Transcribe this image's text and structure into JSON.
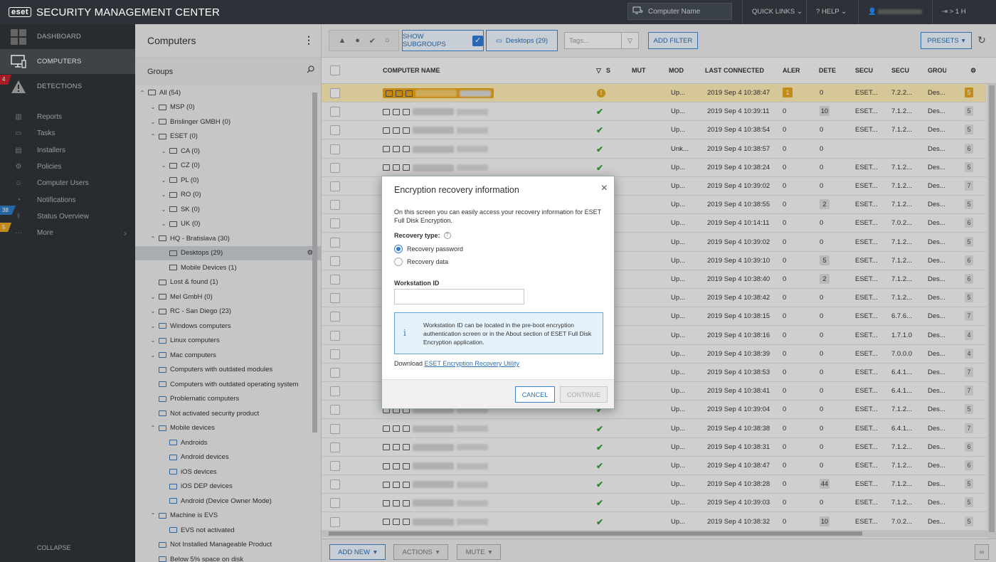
{
  "app": {
    "brand": "eset",
    "title": "SECURITY MANAGEMENT CENTER",
    "search_placeholder": "Computer Name",
    "quick_links": "QUICK LINKS",
    "help": "HELP",
    "logout": "> 1 H"
  },
  "sidebar": {
    "main": [
      {
        "label": "DASHBOARD",
        "icon": "dashboard-icon"
      },
      {
        "label": "COMPUTERS",
        "icon": "computers-icon"
      },
      {
        "label": "DETECTIONS",
        "icon": "warning-icon"
      }
    ],
    "sub": [
      {
        "label": "Reports",
        "icon": "reports-icon"
      },
      {
        "label": "Tasks",
        "icon": "tasks-icon"
      },
      {
        "label": "Installers",
        "icon": "installers-icon"
      },
      {
        "label": "Policies",
        "icon": "policies-icon"
      },
      {
        "label": "Computer Users",
        "icon": "user-icon"
      },
      {
        "label": "Notifications",
        "icon": "bell-icon"
      },
      {
        "label": "Status Overview",
        "icon": "status-icon"
      },
      {
        "label": "More",
        "icon": "more-icon"
      }
    ],
    "badges": {
      "detections": "4",
      "status": "38",
      "more": "5"
    },
    "collapse": "COLLAPSE"
  },
  "tree": {
    "title": "Computers",
    "groups_label": "Groups",
    "nodes": [
      {
        "label": "All (54)",
        "level": 0,
        "caret": "up",
        "dyn": false
      },
      {
        "label": "MSP (0)",
        "level": 1,
        "caret": "down",
        "dyn": false
      },
      {
        "label": "Brislinger GMBH (0)",
        "level": 1,
        "caret": "down",
        "dyn": false
      },
      {
        "label": "ESET (0)",
        "level": 1,
        "caret": "up",
        "dyn": false
      },
      {
        "label": "CA (0)",
        "level": 2,
        "caret": "down",
        "dyn": false
      },
      {
        "label": "CZ (0)",
        "level": 2,
        "caret": "down",
        "dyn": false
      },
      {
        "label": "PL (0)",
        "level": 2,
        "caret": "down",
        "dyn": false
      },
      {
        "label": "RO (0)",
        "level": 2,
        "caret": "down",
        "dyn": false
      },
      {
        "label": "SK (0)",
        "level": 2,
        "caret": "down",
        "dyn": false
      },
      {
        "label": "UK (0)",
        "level": 2,
        "caret": "down",
        "dyn": false
      },
      {
        "label": "HQ - Bratislava (30)",
        "level": 1,
        "caret": "up",
        "dyn": false
      },
      {
        "label": "Desktops (29)",
        "level": 2,
        "caret": "",
        "dyn": false,
        "selected": true
      },
      {
        "label": "Mobile Devices (1)",
        "level": 2,
        "caret": "",
        "dyn": false
      },
      {
        "label": "Lost & found (1)",
        "level": 1,
        "caret": "",
        "dyn": false
      },
      {
        "label": "Mel GmbH (0)",
        "level": 1,
        "caret": "down",
        "dyn": false
      },
      {
        "label": "RC - San Diego (23)",
        "level": 1,
        "caret": "down",
        "dyn": false
      },
      {
        "label": "Windows computers",
        "level": 1,
        "caret": "down",
        "dyn": true
      },
      {
        "label": "Linux computers",
        "level": 1,
        "caret": "down",
        "dyn": true
      },
      {
        "label": "Mac computers",
        "level": 1,
        "caret": "down",
        "dyn": true
      },
      {
        "label": "Computers with outdated modules",
        "level": 1,
        "caret": "",
        "dyn": true
      },
      {
        "label": "Computers with outdated operating system",
        "level": 1,
        "caret": "",
        "dyn": true
      },
      {
        "label": "Problematic computers",
        "level": 1,
        "caret": "",
        "dyn": true
      },
      {
        "label": "Not activated security product",
        "level": 1,
        "caret": "",
        "dyn": true
      },
      {
        "label": "Mobile devices",
        "level": 1,
        "caret": "up",
        "dyn": true
      },
      {
        "label": "Androids",
        "level": 2,
        "caret": "",
        "dyn": true
      },
      {
        "label": "Android devices",
        "level": 2,
        "caret": "",
        "dyn": true
      },
      {
        "label": "iOS devices",
        "level": 2,
        "caret": "",
        "dyn": true
      },
      {
        "label": "iOS DEP devices",
        "level": 2,
        "caret": "",
        "dyn": true
      },
      {
        "label": "Android (Device Owner Mode)",
        "level": 2,
        "caret": "",
        "dyn": true
      },
      {
        "label": "Machine is EVS",
        "level": 1,
        "caret": "up",
        "dyn": true
      },
      {
        "label": "EVS not activated",
        "level": 2,
        "caret": "",
        "dyn": true
      },
      {
        "label": "Not Installed Manageable Product",
        "level": 1,
        "caret": "",
        "dyn": true
      },
      {
        "label": "Below 5% space on disk",
        "level": 1,
        "caret": "",
        "dyn": true
      }
    ]
  },
  "toolbar": {
    "show_subgroups": "SHOW SUBGROUPS",
    "group_filter": "Desktops (29)",
    "tags_placeholder": "Tags...",
    "add_filter": "ADD FILTER",
    "presets": "PRESETS"
  },
  "table": {
    "headers": [
      "COMPUTER NAME",
      "S",
      "MUT",
      "MOD",
      "LAST CONNECTED",
      "ALER",
      "DETE",
      "SECU",
      "SECU",
      "GROU"
    ],
    "rows": [
      {
        "status": "warn",
        "mod": "Up...",
        "last": "2019 Sep 4 10:38:47",
        "alerts": "1",
        "det": "0",
        "secu1": "ESET...",
        "secu2": "7.2.2...",
        "group": "Des...",
        "cnt": "5",
        "hl": true
      },
      {
        "status": "ok",
        "mod": "Up...",
        "last": "2019 Sep 4 10:39:11",
        "alerts": "0",
        "det": "10",
        "secu1": "ESET...",
        "secu2": "7.1.2...",
        "group": "Des...",
        "cnt": "5"
      },
      {
        "status": "ok",
        "mod": "Up...",
        "last": "2019 Sep 4 10:38:54",
        "alerts": "0",
        "det": "0",
        "secu1": "ESET...",
        "secu2": "7.1.2...",
        "group": "Des...",
        "cnt": "5"
      },
      {
        "status": "ok",
        "mod": "Unk...",
        "last": "2019 Sep 4 10:38:57",
        "alerts": "0",
        "det": "0",
        "secu1": "",
        "secu2": "",
        "group": "Des...",
        "cnt": "6"
      },
      {
        "status": "ok",
        "mod": "Up...",
        "last": "2019 Sep 4 10:38:24",
        "alerts": "0",
        "det": "0",
        "secu1": "ESET...",
        "secu2": "7.1.2...",
        "group": "Des...",
        "cnt": "5"
      },
      {
        "status": "ok",
        "mod": "Up...",
        "last": "2019 Sep 4 10:39:02",
        "alerts": "0",
        "det": "0",
        "secu1": "ESET...",
        "secu2": "7.1.2...",
        "group": "Des...",
        "cnt": "7"
      },
      {
        "status": "ok",
        "mod": "Up...",
        "last": "2019 Sep 4 10:38:55",
        "alerts": "0",
        "det": "2",
        "secu1": "ESET...",
        "secu2": "7.1.2...",
        "group": "Des...",
        "cnt": "5"
      },
      {
        "status": "ok",
        "mod": "Up...",
        "last": "2019 Sep 4 10:14:11",
        "alerts": "0",
        "det": "0",
        "secu1": "ESET...",
        "secu2": "7.0.2...",
        "group": "Des...",
        "cnt": "6"
      },
      {
        "status": "ok",
        "mod": "Up...",
        "last": "2019 Sep 4 10:39:02",
        "alerts": "0",
        "det": "0",
        "secu1": "ESET...",
        "secu2": "7.1.2...",
        "group": "Des...",
        "cnt": "5"
      },
      {
        "status": "ok",
        "mod": "Up...",
        "last": "2019 Sep 4 10:39:10",
        "alerts": "0",
        "det": "5",
        "secu1": "ESET...",
        "secu2": "7.1.2...",
        "group": "Des...",
        "cnt": "6"
      },
      {
        "status": "ok",
        "mod": "Up...",
        "last": "2019 Sep 4 10:38:40",
        "alerts": "0",
        "det": "2",
        "secu1": "ESET...",
        "secu2": "7.1.2...",
        "group": "Des...",
        "cnt": "6"
      },
      {
        "status": "ok",
        "mod": "Up...",
        "last": "2019 Sep 4 10:38:42",
        "alerts": "0",
        "det": "0",
        "secu1": "ESET...",
        "secu2": "7.1.2...",
        "group": "Des...",
        "cnt": "5"
      },
      {
        "status": "ok",
        "mod": "Up...",
        "last": "2019 Sep 4 10:38:15",
        "alerts": "0",
        "det": "0",
        "secu1": "ESET...",
        "secu2": "6.7.6...",
        "group": "Des...",
        "cnt": "7"
      },
      {
        "status": "ok",
        "mod": "Up...",
        "last": "2019 Sep 4 10:38:16",
        "alerts": "0",
        "det": "0",
        "secu1": "ESET...",
        "secu2": "1.7.1.0",
        "group": "Des...",
        "cnt": "4"
      },
      {
        "status": "ok",
        "mod": "Up...",
        "last": "2019 Sep 4 10:38:39",
        "alerts": "0",
        "det": "0",
        "secu1": "ESET...",
        "secu2": "7.0.0.0",
        "group": "Des...",
        "cnt": "4"
      },
      {
        "status": "ok",
        "mod": "Up...",
        "last": "2019 Sep 4 10:38:53",
        "alerts": "0",
        "det": "0",
        "secu1": "ESET...",
        "secu2": "6.4.1...",
        "group": "Des...",
        "cnt": "7"
      },
      {
        "status": "ok",
        "mod": "Up...",
        "last": "2019 Sep 4 10:38:41",
        "alerts": "0",
        "det": "0",
        "secu1": "ESET...",
        "secu2": "6.4.1...",
        "group": "Des...",
        "cnt": "7"
      },
      {
        "status": "ok",
        "mod": "Up...",
        "last": "2019 Sep 4 10:39:04",
        "alerts": "0",
        "det": "0",
        "secu1": "ESET...",
        "secu2": "7.1.2...",
        "group": "Des...",
        "cnt": "5"
      },
      {
        "status": "ok",
        "mod": "Up...",
        "last": "2019 Sep 4 10:38:38",
        "alerts": "0",
        "det": "0",
        "secu1": "ESET...",
        "secu2": "6.4.1...",
        "group": "Des...",
        "cnt": "7"
      },
      {
        "status": "ok",
        "mod": "Up...",
        "last": "2019 Sep 4 10:38:31",
        "alerts": "0",
        "det": "0",
        "secu1": "ESET...",
        "secu2": "7.1.2...",
        "group": "Des...",
        "cnt": "6"
      },
      {
        "status": "ok",
        "mod": "Up...",
        "last": "2019 Sep 4 10:38:47",
        "alerts": "0",
        "det": "0",
        "secu1": "ESET...",
        "secu2": "7.1.2...",
        "group": "Des...",
        "cnt": "6"
      },
      {
        "status": "ok",
        "mod": "Up...",
        "last": "2019 Sep 4 10:38:28",
        "alerts": "0",
        "det": "44",
        "secu1": "ESET...",
        "secu2": "7.1.2...",
        "group": "Des...",
        "cnt": "5"
      },
      {
        "status": "ok",
        "mod": "Up...",
        "last": "2019 Sep 4 10:39:03",
        "alerts": "0",
        "det": "0",
        "secu1": "ESET...",
        "secu2": "7.1.2...",
        "group": "Des...",
        "cnt": "5"
      },
      {
        "status": "ok",
        "mod": "Up...",
        "last": "2019 Sep 4 10:38:32",
        "alerts": "0",
        "det": "10",
        "secu1": "ESET...",
        "secu2": "7.0.2...",
        "group": "Des...",
        "cnt": "5"
      }
    ]
  },
  "bottom": {
    "add_new": "ADD NEW",
    "actions": "ACTIONS",
    "mute": "MUTE"
  },
  "dialog": {
    "title": "Encryption recovery information",
    "description": "On this screen you can easily access your recovery information for ESET Full Disk Encryption.",
    "recovery_type_label": "Recovery type:",
    "options": [
      "Recovery password",
      "Recovery data"
    ],
    "selected_option": "Recovery password",
    "workstation_label": "Workstation ID",
    "workstation_value": "",
    "info_text": "Workstation ID can be located in the pre-boot encryption authentication screen or in the About section of ESET Full Disk Encryption application.",
    "download_prefix": "Download",
    "download_link": "ESET Encryption Recovery Utility",
    "cancel": "CANCEL",
    "continue": "CONTINUE"
  },
  "colors": {
    "accent": "#3b86cf",
    "topbar": "#2d3239",
    "sidebar": "#2f3439",
    "warning": "#e3a51e",
    "ok": "#3a9c3a",
    "danger": "#c3232a"
  }
}
